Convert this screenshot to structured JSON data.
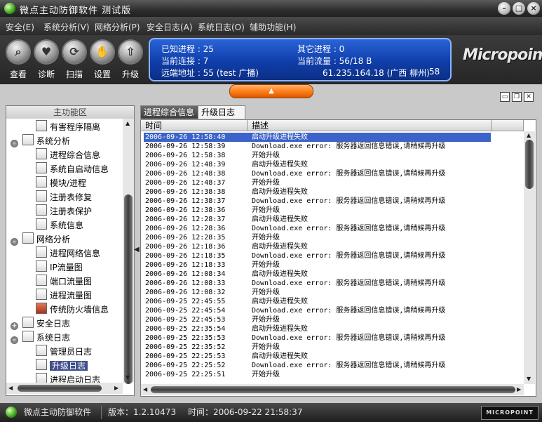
{
  "window": {
    "title": "微点主动防御软件  测试版",
    "controls": [
      "minimize",
      "maximize",
      "close"
    ]
  },
  "menu": [
    "安全(E)",
    "系统分析(V)",
    "网络分析(P)",
    "安全日志(A)",
    "系统日志(O)",
    "辅助功能(H)"
  ],
  "toolbar": {
    "buttons": [
      {
        "label": "查看",
        "icon": "magnifier-icon"
      },
      {
        "label": "诊断",
        "icon": "stethoscope-icon"
      },
      {
        "label": "扫描",
        "icon": "scan-icon"
      },
      {
        "label": "设置",
        "icon": "settings-icon"
      },
      {
        "label": "升级",
        "icon": "upgrade-icon"
      }
    ]
  },
  "info": {
    "known_processes": "已知进程 : 25",
    "other_processes": "其它进程 : 0",
    "current_connections": "当前连接 : 7",
    "current_traffic": "当前流量 : 56/18 B",
    "remote_address": "远端地址 :  55 (test 广播)",
    "remote_ip": "61.235.164.18 (广西 柳州)",
    "remote_count": "58"
  },
  "brand": {
    "logo": "Micropoint",
    "status_logo": "MICROPOINT"
  },
  "left_panel": {
    "header": "主功能区",
    "tree": [
      {
        "label": "有害程序隔离",
        "level": 2,
        "type": "item"
      },
      {
        "label": "系统分析",
        "level": 1,
        "type": "group"
      },
      {
        "label": "进程综合信息",
        "level": 2,
        "type": "item"
      },
      {
        "label": "系统自启动信息",
        "level": 2,
        "type": "item"
      },
      {
        "label": "模块/进程",
        "level": 2,
        "type": "item"
      },
      {
        "label": "注册表修复",
        "level": 2,
        "type": "item"
      },
      {
        "label": "注册表保护",
        "level": 2,
        "type": "item"
      },
      {
        "label": "系统信息",
        "level": 2,
        "type": "item"
      },
      {
        "label": "网络分析",
        "level": 1,
        "type": "group"
      },
      {
        "label": "进程网络信息",
        "level": 2,
        "type": "item"
      },
      {
        "label": "IP流量图",
        "level": 2,
        "type": "item"
      },
      {
        "label": "端口流量图",
        "level": 2,
        "type": "item"
      },
      {
        "label": "进程流量图",
        "level": 2,
        "type": "item"
      },
      {
        "label": "传统防火墙信息",
        "level": 2,
        "type": "item"
      },
      {
        "label": "安全日志",
        "level": 1,
        "type": "group"
      },
      {
        "label": "系统日志",
        "level": 1,
        "type": "group"
      },
      {
        "label": "管理员日志",
        "level": 2,
        "type": "item"
      },
      {
        "label": "升级日志",
        "level": 2,
        "type": "item",
        "selected": true
      },
      {
        "label": "进程启动日志",
        "level": 2,
        "type": "item"
      }
    ]
  },
  "tabs": [
    "进程综合信息",
    "升级日志"
  ],
  "log_table": {
    "columns": [
      "时间",
      "描述"
    ],
    "rows": [
      [
        "2006-09-26 12:58:40",
        "启动升级进程失败"
      ],
      [
        "2006-09-26 12:58:39",
        "Download.exe error: 服务器返回信息错误,请稍候再升级"
      ],
      [
        "2006-09-26 12:58:38",
        "开始升级"
      ],
      [
        "2006-09-26 12:48:39",
        "启动升级进程失败"
      ],
      [
        "2006-09-26 12:48:38",
        "Download.exe error: 服务器返回信息错误,请稍候再升级"
      ],
      [
        "2006-09-26 12:48:37",
        "开始升级"
      ],
      [
        "2006-09-26 12:38:38",
        "启动升级进程失败"
      ],
      [
        "2006-09-26 12:38:37",
        "Download.exe error: 服务器返回信息错误,请稍候再升级"
      ],
      [
        "2006-09-26 12:38:36",
        "开始升级"
      ],
      [
        "2006-09-26 12:28:37",
        "启动升级进程失败"
      ],
      [
        "2006-09-26 12:28:36",
        "Download.exe error: 服务器返回信息错误,请稍候再升级"
      ],
      [
        "2006-09-26 12:28:35",
        "开始升级"
      ],
      [
        "2006-09-26 12:18:36",
        "启动升级进程失败"
      ],
      [
        "2006-09-26 12:18:35",
        "Download.exe error: 服务器返回信息错误,请稍候再升级"
      ],
      [
        "2006-09-26 12:18:33",
        "开始升级"
      ],
      [
        "2006-09-26 12:08:34",
        "启动升级进程失败"
      ],
      [
        "2006-09-26 12:08:33",
        "Download.exe error: 服务器返回信息错误,请稍候再升级"
      ],
      [
        "2006-09-26 12:08:32",
        "开始升级"
      ],
      [
        "2006-09-25 22:45:55",
        "启动升级进程失败"
      ],
      [
        "2006-09-25 22:45:54",
        "Download.exe error: 服务器返回信息错误,请稍候再升级"
      ],
      [
        "2006-09-25 22:45:53",
        "开始升级"
      ],
      [
        "2006-09-25 22:35:54",
        "启动升级进程失败"
      ],
      [
        "2006-09-25 22:35:53",
        "Download.exe error: 服务器返回信息错误,请稍候再升级"
      ],
      [
        "2006-09-25 22:35:52",
        "开始升级"
      ],
      [
        "2006-09-25 22:25:53",
        "启动升级进程失败"
      ],
      [
        "2006-09-25 22:25:52",
        "Download.exe error: 服务器返回信息错误,请稍候再升级"
      ],
      [
        "2006-09-25 22:25:51",
        "开始升级"
      ]
    ],
    "selected_row": 0
  },
  "status": {
    "app_name": "微点主动防御软件",
    "version": "版本：1.2.10473",
    "time": "时间：2006-09-22 21:58:37"
  }
}
